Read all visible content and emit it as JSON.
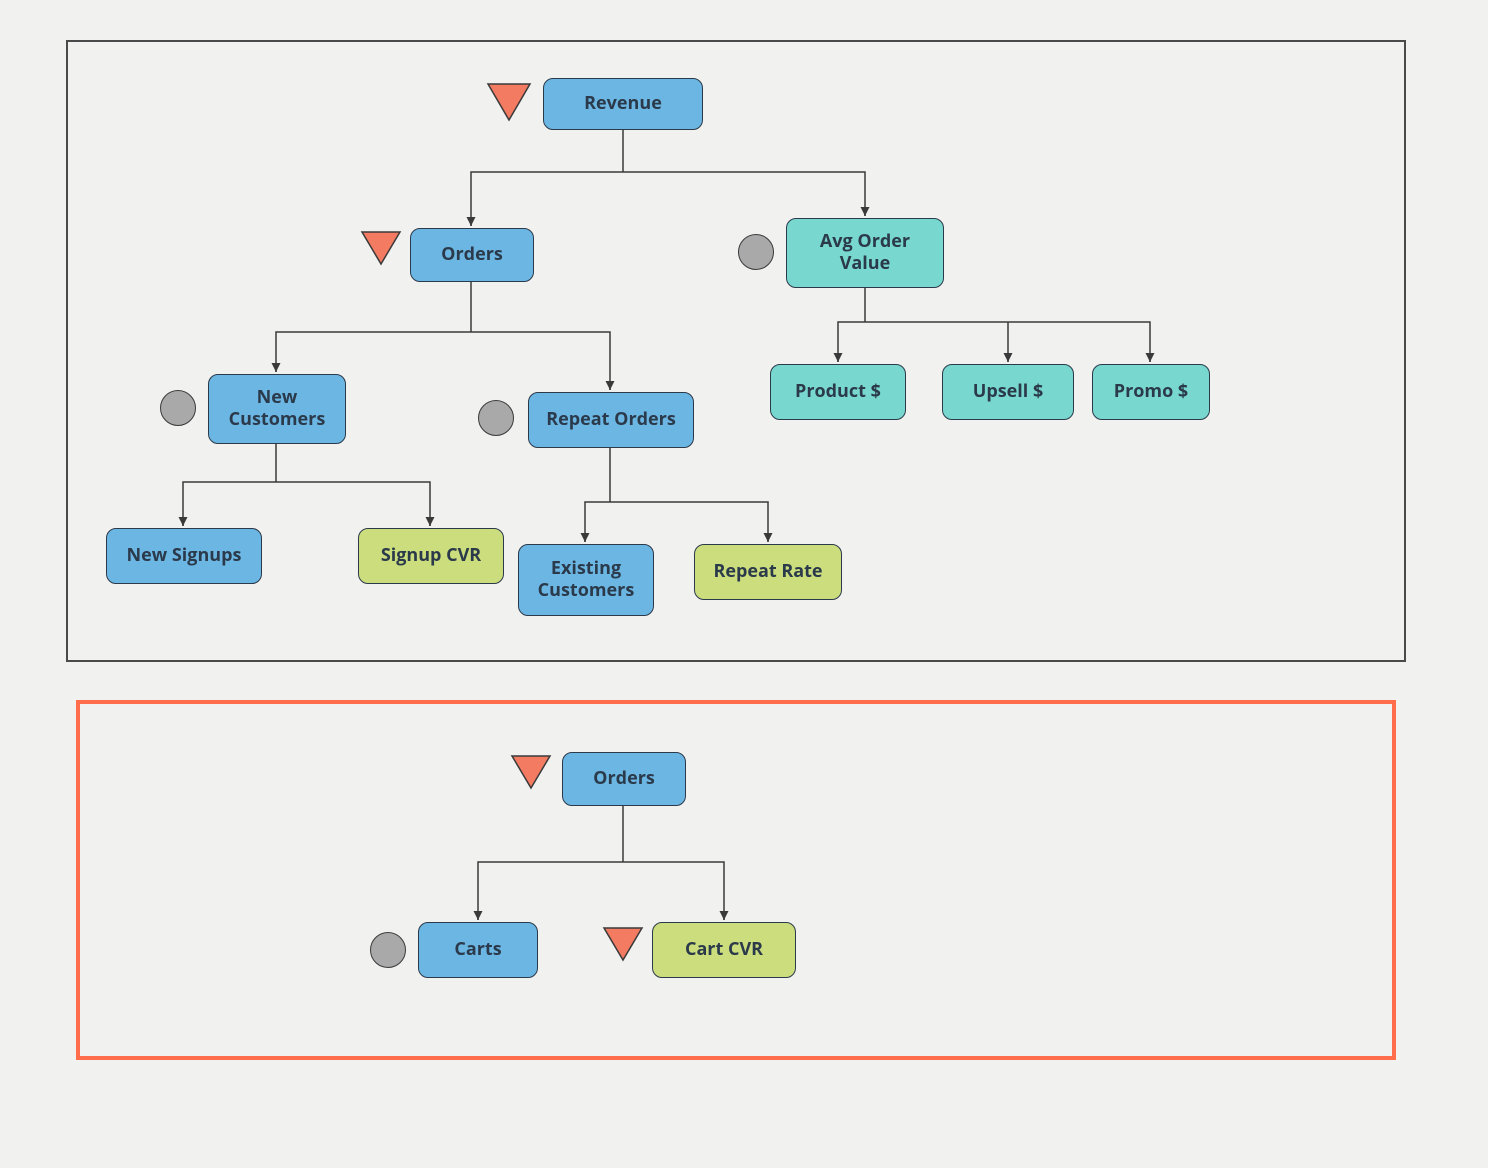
{
  "colors": {
    "blue": "#6cb6e4",
    "teal": "#78d8cf",
    "green": "#cbdd7d",
    "triangle": "#f27b62",
    "circle": "#a9a9a9",
    "border_top": "#4a4a4a",
    "border_bottom": "#ff6d4c",
    "bg": "#f1f1ef"
  },
  "indicators": {
    "triangle_meaning": "down / negative",
    "circle_meaning": "neutral / unchanged"
  },
  "top_tree": {
    "root": {
      "label": "Revenue",
      "indicator": "triangle",
      "color": "blue"
    },
    "children": [
      {
        "label": "Orders",
        "indicator": "triangle",
        "color": "blue",
        "children": [
          {
            "label": "New Customers",
            "indicator": "circle",
            "color": "blue",
            "children": [
              {
                "label": "New Signups",
                "color": "blue"
              },
              {
                "label": "Signup CVR",
                "color": "green"
              }
            ]
          },
          {
            "label": "Repeat Orders",
            "indicator": "circle",
            "color": "blue",
            "children": [
              {
                "label": "Existing Customers",
                "color": "blue"
              },
              {
                "label": "Repeat Rate",
                "color": "green"
              }
            ]
          }
        ]
      },
      {
        "label": "Avg Order Value",
        "indicator": "circle",
        "color": "teal",
        "children": [
          {
            "label": "Product $",
            "color": "teal"
          },
          {
            "label": "Upsell $",
            "color": "teal"
          },
          {
            "label": "Promo $",
            "color": "teal"
          }
        ]
      }
    ]
  },
  "bottom_tree": {
    "root": {
      "label": "Orders",
      "indicator": "triangle",
      "color": "blue"
    },
    "children": [
      {
        "label": "Carts",
        "indicator": "circle",
        "color": "blue"
      },
      {
        "label": "Cart CVR",
        "indicator": "triangle",
        "color": "green"
      }
    ]
  }
}
